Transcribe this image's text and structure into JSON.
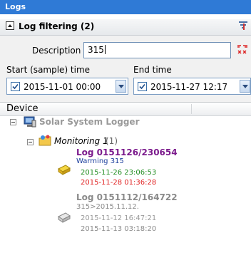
{
  "window": {
    "title": "Logs"
  },
  "filter": {
    "header": "Log filtering (2)",
    "description_label": "Description",
    "description_value": "315",
    "start_label": "Start (sample) time",
    "start_value": "2015-11-01 00:00",
    "end_label": "End time",
    "end_value": "2015-11-27 12:17"
  },
  "tree": {
    "column_header": "Device",
    "root_label": "Solar System Logger",
    "monitoring_label": "Monitoring 1",
    "monitoring_count": "(1)",
    "logs": [
      {
        "title": "Log 0151126/230654",
        "description": "Warming 315",
        "start": "2015-11-26 23:06:53",
        "end": "2015-11-28 01:36:28",
        "title_color": "#7b1a8c",
        "description_color": "#1a3d9c",
        "start_color": "#1e8c1e",
        "end_color": "#e02020"
      },
      {
        "title": "Log 0151112/164722",
        "description": "315>2015.11.12.",
        "start": "2015-11-12 16:47:21",
        "end": "2015-11-13 03:18:20",
        "title_color": "#8a8a8a",
        "description_color": "#8a8a8a",
        "start_color": "#9a9a9a",
        "end_color": "#8a8a8a"
      }
    ]
  }
}
